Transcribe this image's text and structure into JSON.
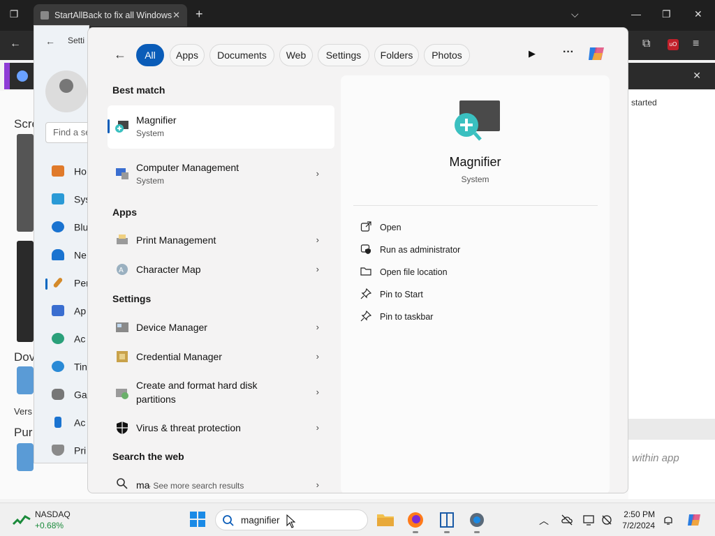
{
  "browser": {
    "tab_title": "StartAllBack to fix all Windows",
    "tab_close": "✕",
    "new_tab": "+"
  },
  "background": {
    "left_fragments": [
      "Scre",
      "Dov",
      "Vers",
      "Pur"
    ],
    "right_text_fragment": "started",
    "right_italic": ") within app"
  },
  "settings": {
    "title": "Setti",
    "search_placeholder": "Find a se",
    "nav_items": [
      {
        "label": "Ho",
        "icon": "home-icon"
      },
      {
        "label": "Sys",
        "icon": "system-icon"
      },
      {
        "label": "Blu",
        "icon": "bluetooth-icon"
      },
      {
        "label": "Ne",
        "icon": "network-icon"
      },
      {
        "label": "Per",
        "icon": "personalization-icon"
      },
      {
        "label": "Ap",
        "icon": "apps-icon"
      },
      {
        "label": "Ac",
        "icon": "accounts-icon"
      },
      {
        "label": "Tin",
        "icon": "time-icon"
      },
      {
        "label": "Ga",
        "icon": "gaming-icon"
      },
      {
        "label": "Ac",
        "icon": "accessibility-icon"
      },
      {
        "label": "Pri",
        "icon": "privacy-icon"
      }
    ]
  },
  "search_panel": {
    "filters": [
      "All",
      "Apps",
      "Documents",
      "Web",
      "Settings",
      "Folders",
      "Photos"
    ],
    "active_filter": "All",
    "best_match_heading": "Best match",
    "best_match": {
      "name": "Magnifier",
      "type": "System"
    },
    "computer_management": {
      "name": "Computer Management",
      "type": "System"
    },
    "apps_heading": "Apps",
    "apps": [
      {
        "name": "Print Management"
      },
      {
        "name": "Character Map"
      }
    ],
    "settings_heading": "Settings",
    "settings_results": [
      {
        "name": "Device Manager"
      },
      {
        "name": "Credential Manager"
      },
      {
        "name": "Create and format hard disk",
        "name2": "partitions"
      },
      {
        "name": "Virus & threat protection"
      }
    ],
    "web_heading": "Search the web",
    "web_result": {
      "query": "ma",
      "suffix": " - See more search results"
    },
    "detail": {
      "name": "Magnifier",
      "type": "System",
      "actions": [
        {
          "label": "Open",
          "icon": "open-icon"
        },
        {
          "label": "Run as administrator",
          "icon": "admin-shield-icon"
        },
        {
          "label": "Open file location",
          "icon": "folder-icon"
        },
        {
          "label": "Pin to Start",
          "icon": "pin-icon"
        },
        {
          "label": "Pin to taskbar",
          "icon": "pin-icon"
        }
      ]
    }
  },
  "taskbar": {
    "stock_name": "NASDAQ",
    "stock_change": "+0.68%",
    "search_value": "magnifier",
    "time": "2:50 PM",
    "date": "7/2/2024"
  },
  "colors": {
    "accent": "#0a5cb8",
    "stock_green": "#1a8a3a"
  }
}
